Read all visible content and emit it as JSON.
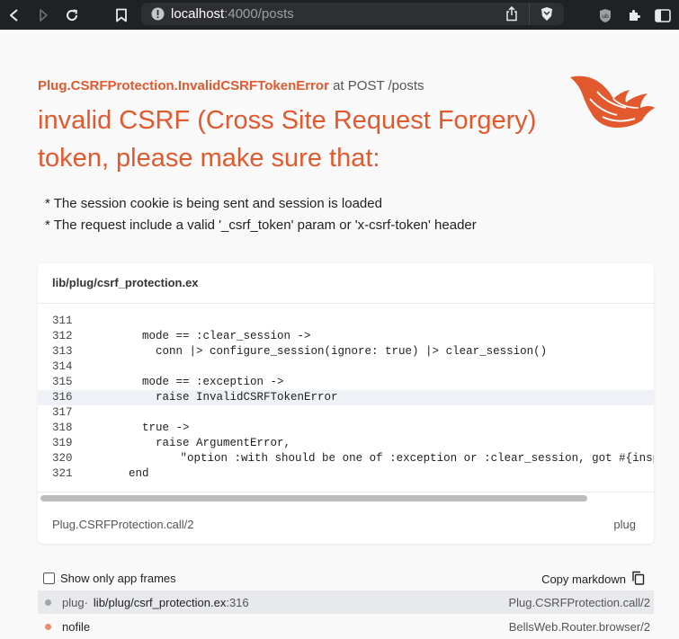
{
  "browser": {
    "url_host": "localhost",
    "url_path": ":4000/posts"
  },
  "error": {
    "exception": "Plug.CSRFProtection.InvalidCSRFTokenError",
    "location": " at POST /posts",
    "headline": "invalid CSRF (Cross Site Request Forgery) token, please make sure that:",
    "bullets": [
      "* The session cookie is being sent and session is loaded",
      "* The request include a valid '_csrf_token' param or 'x-csrf-token' header"
    ]
  },
  "code_card": {
    "file": "lib/plug/csrf_protection.ex",
    "highlighted_line": "316",
    "lines": [
      {
        "n": "311",
        "src": ""
      },
      {
        "n": "312",
        "src": "        mode == :clear_session ->"
      },
      {
        "n": "313",
        "src": "          conn |> configure_session(ignore: true) |> clear_session()"
      },
      {
        "n": "314",
        "src": ""
      },
      {
        "n": "315",
        "src": "        mode == :exception ->"
      },
      {
        "n": "316",
        "src": "          raise InvalidCSRFTokenError"
      },
      {
        "n": "317",
        "src": ""
      },
      {
        "n": "318",
        "src": "        true ->"
      },
      {
        "n": "319",
        "src": "          raise ArgumentError,"
      },
      {
        "n": "320",
        "src": "                \"option :with should be one of :exception or :clear_session, got #{insp"
      },
      {
        "n": "321",
        "src": "      end"
      }
    ],
    "function": "Plug.CSRFProtection.call/2",
    "app": "plug"
  },
  "controls": {
    "show_app_frames": "Show only app frames",
    "show_app_frames_checked": false,
    "copy_markdown": "Copy markdown"
  },
  "frames": [
    {
      "color": "#a0a4ad",
      "app": "plug",
      "sep": " · ",
      "file": "lib/plug/csrf_protection.ex",
      "line": ":316",
      "func": "Plug.CSRFProtection.call/2",
      "active": true
    },
    {
      "color": "#f08a6e",
      "app": "",
      "sep": "",
      "file": "nofile",
      "line": "",
      "func": "BellsWeb.Router.browser/2",
      "active": false
    }
  ]
}
